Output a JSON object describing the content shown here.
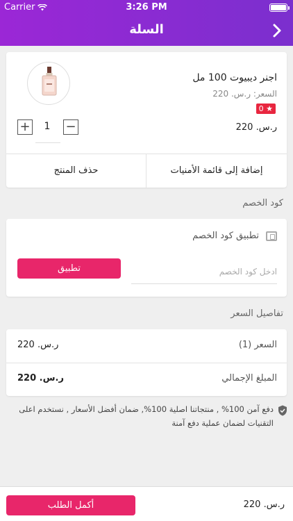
{
  "status_bar": {
    "carrier": "Carrier",
    "time": "3:26 PM"
  },
  "navbar": {
    "title": "السلة",
    "back_icon": "chevron-right-icon"
  },
  "product": {
    "name": "اجنر ديبيوت 100 مل",
    "price_label": "السعر: ر.س. 220",
    "rating_badge": "★ 0",
    "line_total": "ر.س. 220",
    "quantity": "1",
    "add_to_wishlist": "إضافة إلى قائمة الأمنيات",
    "remove": "حذف المنتج"
  },
  "coupon": {
    "section_title": "كود الخصم",
    "apply_label": "تطبيق كود الخصم",
    "input_placeholder": "ادخل كود الخصم",
    "apply_button": "تطبيق"
  },
  "price_details": {
    "section_title": "تفاصيل السعر",
    "rows": [
      {
        "label": "السعر (1)",
        "value": "ر.س. 220"
      },
      {
        "label": "المبلغ الإجمالي",
        "value": "ر.س. 220"
      }
    ]
  },
  "security_note": "دفع آمن 100% , منتجاتنا اصلية 100%, ضمان أفضل الأسعار , نستخدم اعلى التقنيات لضمان عملية دفع آمنة",
  "bottom_bar": {
    "checkout_button": "أكمل الطلب",
    "total": "ر.س. 220"
  },
  "colors": {
    "header": "#8a2be2",
    "accent": "#e8266a",
    "badge": "#e8263f"
  }
}
